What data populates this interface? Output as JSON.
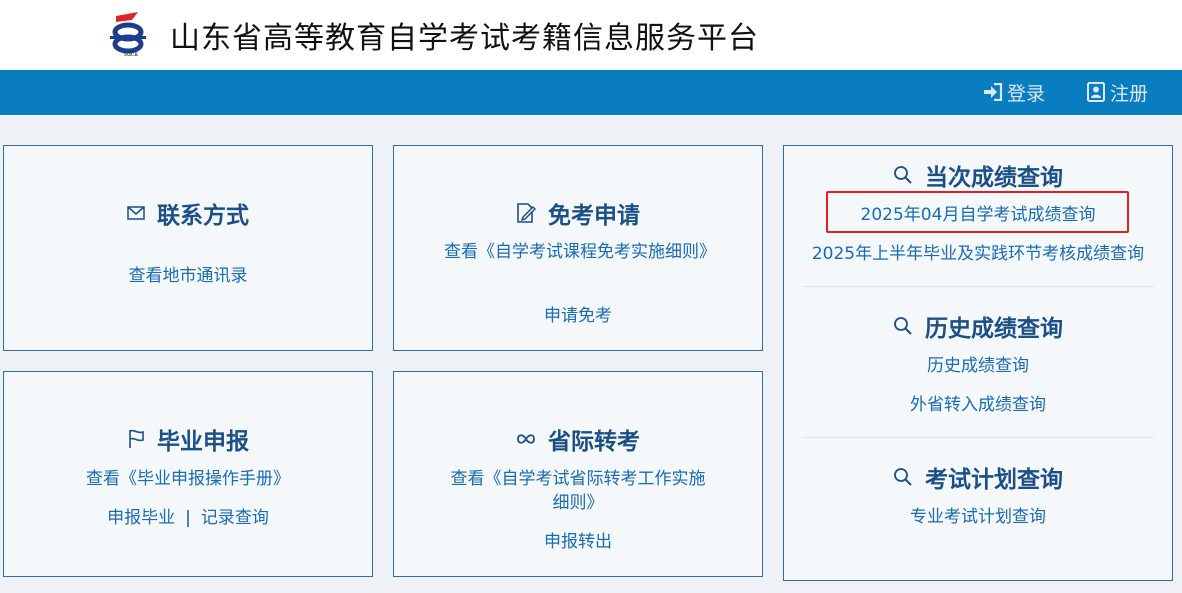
{
  "header": {
    "logo_text": "sdck",
    "title": "山东省高等教育自学考试考籍信息服务平台"
  },
  "nav": {
    "login": "登录",
    "register": "注册"
  },
  "cards": {
    "contact": {
      "title": "联系方式",
      "link": "查看地市通讯录"
    },
    "exemption": {
      "title": "免考申请",
      "rules_link": "查看《自学考试课程免考实施细则》",
      "apply_link": "申请免考"
    },
    "graduation": {
      "title": "毕业申报",
      "manual_link": "查看《毕业申报操作手册》",
      "apply_link": "申报毕业",
      "separator": "|",
      "records_link": "记录查询"
    },
    "transfer": {
      "title": "省际转考",
      "rules_link": "查看《自学考试省际转考工作实施细则》",
      "apply_link": "申报转出"
    }
  },
  "score_panel": {
    "current": {
      "title": "当次成绩查询",
      "links": [
        "2025年04月自学考试成绩查询",
        "2025年上半年毕业及实践环节考核成绩查询"
      ]
    },
    "history": {
      "title": "历史成绩查询",
      "links": [
        "历史成绩查询",
        "外省转入成绩查询"
      ]
    },
    "plan": {
      "title": "考试计划查询",
      "links": [
        "专业考试计划查询"
      ]
    }
  },
  "colors": {
    "navbar": "#0a7dc1",
    "title_blue": "#1b4f86",
    "link_blue": "#1a6bb0",
    "highlight_red": "#e0201f"
  }
}
